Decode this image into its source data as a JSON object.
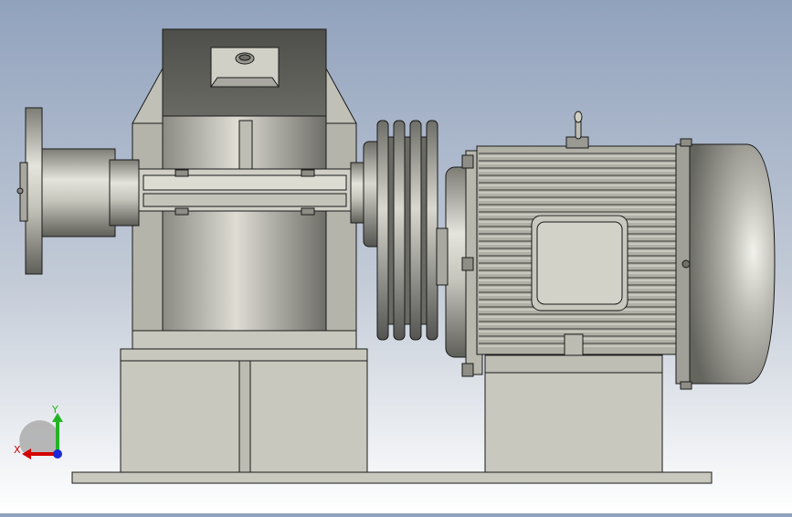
{
  "viewport": {
    "background_top": "#91a2bd",
    "background_bottom": "#ffffff",
    "model_fill": "#c8c8be",
    "model_edge": "#1a1a1a"
  },
  "triad": {
    "x_label": "X",
    "y_label": "Y",
    "x_color": "#d40000",
    "y_color": "#22b422",
    "z_color": "#1a28d8"
  }
}
